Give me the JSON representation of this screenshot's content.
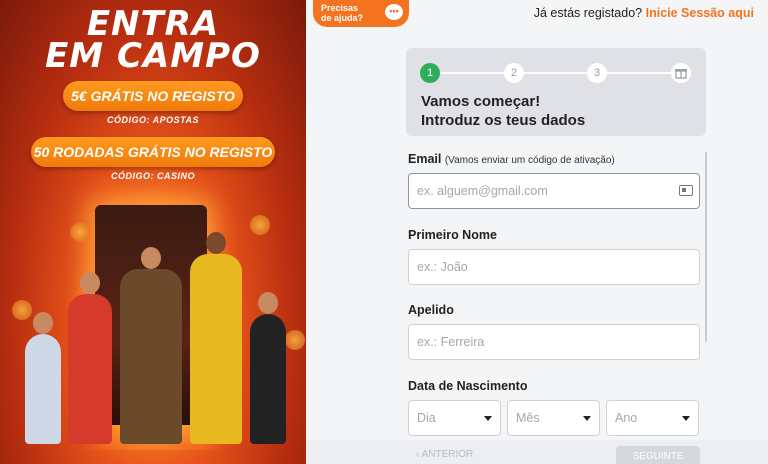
{
  "promo": {
    "headline_line1": "ENTRA",
    "headline_line2": "EM CAMPO",
    "offer1": "5€ GRÁTIS NO REGISTO",
    "code1": "CÓDIGO: APOSTAS",
    "offer2": "50 RODADAS GRÁTIS NO REGISTO",
    "code2": "CÓDIGO: CASINO"
  },
  "header": {
    "help_line1": "Precisas",
    "help_line2": "de ajuda?",
    "chat_icon": "chat-bubble-icon",
    "login_prompt": "Já estás registado?",
    "login_link": "Inicie Sessão aqui"
  },
  "stepper": {
    "steps": [
      "1",
      "2",
      "3"
    ],
    "final_icon": "gift-icon",
    "active_step": 1,
    "title_line1": "Vamos começar!",
    "title_line2": "Introduz os teus dados"
  },
  "form": {
    "email_label": "Email",
    "email_hint": "(Vamos enviar um código de ativação)",
    "email_placeholder": "ex. alguem@gmail.com",
    "email_icon": "id-card-icon",
    "first_name_label": "Primeiro Nome",
    "first_name_placeholder": "ex.: João",
    "last_name_label": "Apelido",
    "last_name_placeholder": "ex.: Ferreira",
    "dob_label": "Data de Nascimento",
    "dob_day": "Dia",
    "dob_month": "Mês",
    "dob_year": "Ano"
  },
  "footer": {
    "back_label": "ANTERIOR",
    "next_label": "SEGUINTE"
  },
  "colors": {
    "accent": "#f4731f",
    "step_active": "#2eae5a"
  }
}
